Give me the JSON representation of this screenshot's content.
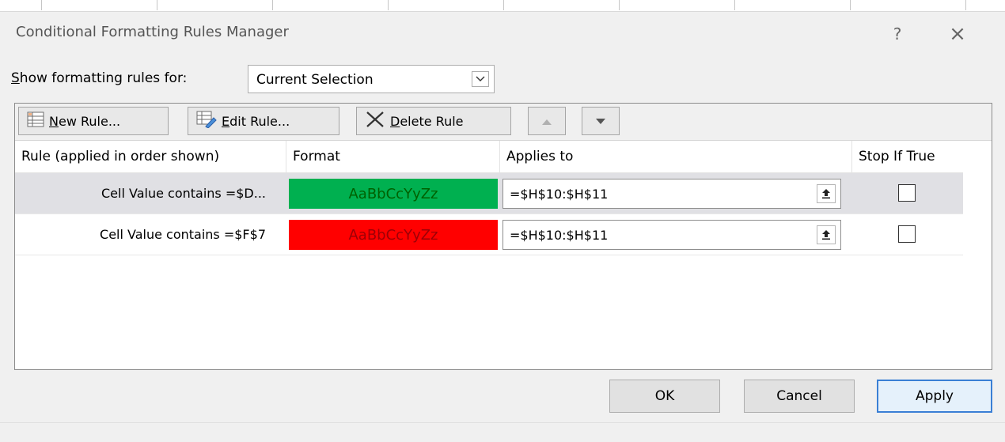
{
  "window": {
    "title": "Conditional Formatting Rules Manager",
    "help_label": "?",
    "close_label": "×"
  },
  "show_rules": {
    "label_prefix": "S",
    "label_rest": "how formatting rules for:",
    "selected": "Current Selection"
  },
  "toolbar": {
    "new_rule": {
      "mnemonic": "N",
      "rest": "ew Rule..."
    },
    "edit_rule": {
      "mnemonic": "E",
      "rest": "dit Rule..."
    },
    "delete_rule": {
      "mnemonic": "D",
      "rest": "elete Rule"
    }
  },
  "table": {
    "headers": [
      "Rule (applied in order shown)",
      "Format",
      "Applies to",
      "Stop If True"
    ],
    "rows": [
      {
        "rule": "Cell Value contains =$D...",
        "format_preview": "AaBbCcYyZz",
        "format_bg": "#00b050",
        "format_fg": "#006100",
        "applies_to": "=$H$10:$H$11",
        "stop_if_true": false,
        "selected": true
      },
      {
        "rule": "Cell Value contains =$F$7",
        "format_preview": "AaBbCcYyZz",
        "format_bg": "#ff0000",
        "format_fg": "#9c0006",
        "applies_to": "=$H$10:$H$11",
        "stop_if_true": false,
        "selected": false
      }
    ]
  },
  "buttons": {
    "ok": "OK",
    "cancel": "Cancel",
    "apply": "Apply"
  },
  "colors": {
    "dialog_bg": "#f0f0f0",
    "accent": "#3a7fd5",
    "selected_row": "#e0e0e4"
  }
}
